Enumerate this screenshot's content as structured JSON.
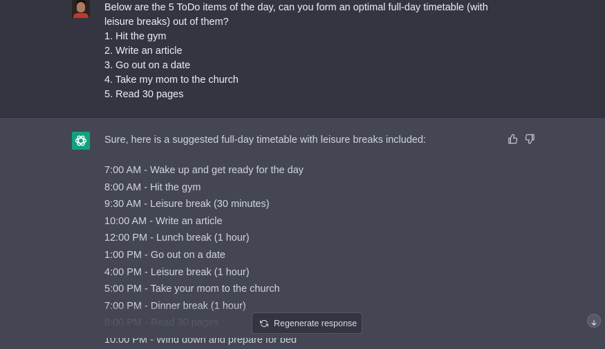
{
  "user_message": {
    "avatar": "user-avatar",
    "prompt": "Below are the 5 ToDo items of the day, can you form an optimal full-day timetable (with leisure breaks) out of them?",
    "items": [
      "1. Hit the gym",
      "2. Write an article",
      "3. Go out on a date",
      "4. Take my mom to the church",
      "5. Read 30 pages"
    ]
  },
  "assistant_message": {
    "avatar": "openai-logo-icon",
    "intro": "Sure, here is a suggested full-day timetable with leisure breaks included:",
    "schedule": [
      "7:00 AM - Wake up and get ready for the day",
      "8:00 AM - Hit the gym",
      "9:30 AM - Leisure break (30 minutes)",
      "10:00 AM - Write an article",
      "12:00 PM - Lunch break (1 hour)",
      "1:00 PM - Go out on a date",
      "4:00 PM - Leisure break (1 hour)",
      "5:00 PM - Take your mom to the church",
      "7:00 PM - Dinner break (1 hour)",
      "8:00 PM - Read 30 pages",
      "10:00 PM - Wind down and prepare for bed"
    ]
  },
  "feedback": {
    "thumbs_up": "thumbs-up-icon",
    "thumbs_down": "thumbs-down-icon"
  },
  "regenerate_button": {
    "label": "Regenerate response",
    "icon": "refresh-icon"
  },
  "scroll_button": {
    "icon": "arrow-down-icon"
  },
  "colors": {
    "user_bg": "#343541",
    "assistant_bg": "#444654",
    "brand": "#10a37f"
  }
}
